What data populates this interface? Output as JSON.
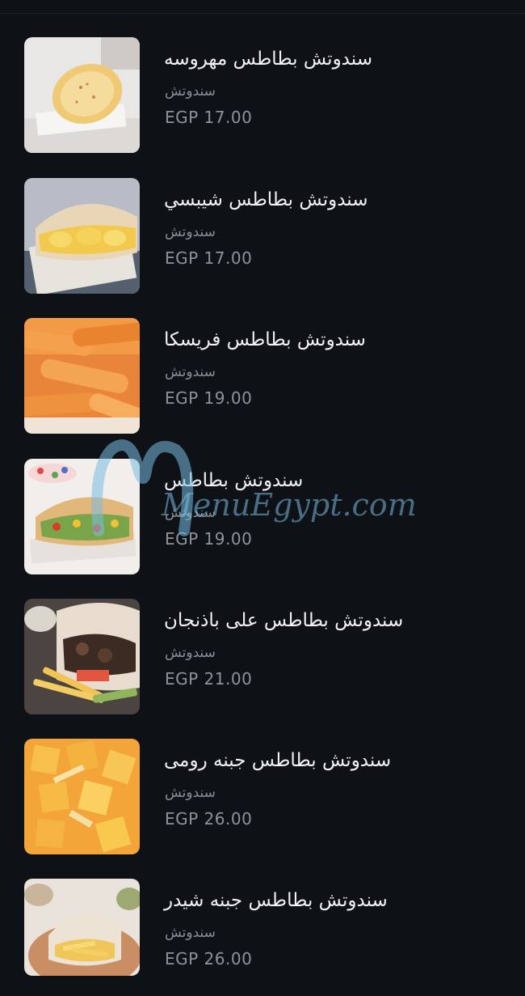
{
  "menu": {
    "items": [
      {
        "title": "سندوتش بطاطس مهروسه",
        "category": "سندوتش",
        "price": "EGP 17.00",
        "image": "mashed-potato-sandwich-photo"
      },
      {
        "title": "سندوتش بطاطس شيبسي",
        "category": "سندوتش",
        "price": "EGP 17.00",
        "image": "chips-sandwich-photo"
      },
      {
        "title": "سندوتش بطاطس فريسكا",
        "category": "سندوتش",
        "price": "EGP 19.00",
        "image": "crispy-fries-photo"
      },
      {
        "title": "سندوتش بطاطس",
        "category": "سندوتش",
        "price": "EGP 19.00",
        "image": "potato-sandwich-photo"
      },
      {
        "title": "سندوتش بطاطس على باذنجان",
        "category": "سندوتش",
        "price": "EGP 21.00",
        "image": "eggplant-sandwich-photo"
      },
      {
        "title": "سندوتش بطاطس جبنه رومى",
        "category": "سندوتش",
        "price": "EGP 26.00",
        "image": "roumy-cheese-fries-photo"
      },
      {
        "title": "سندوتش بطاطس جبنه شيدر",
        "category": "سندوتش",
        "price": "EGP 26.00",
        "image": "cheddar-sandwich-photo"
      }
    ]
  },
  "watermark": {
    "text": "MenuEgypt.com"
  },
  "colors": {
    "background": "#0e1116",
    "title": "#f2f3f5",
    "muted": "#8a8f97"
  }
}
